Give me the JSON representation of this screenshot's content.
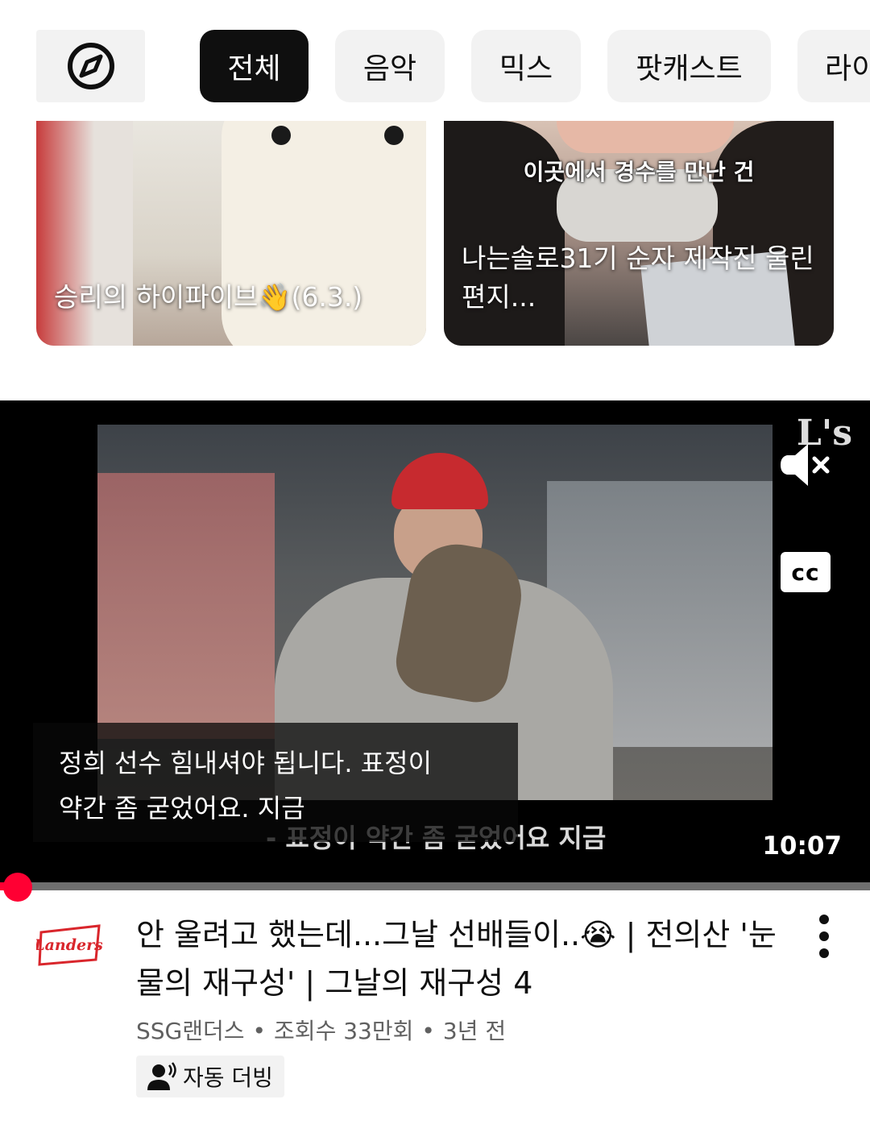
{
  "chips": {
    "explore_icon": "compass-icon",
    "items": [
      {
        "label": "전체",
        "active": true
      },
      {
        "label": "음악",
        "active": false
      },
      {
        "label": "믹스",
        "active": false
      },
      {
        "label": "팟캐스트",
        "active": false
      },
      {
        "label": "라이",
        "active": false
      }
    ]
  },
  "shorts": [
    {
      "title": "승리의 하이파이브👋(6.3.)"
    },
    {
      "overlay_text": "이곳에서 경수를 만난 건",
      "title": "나는솔로31기 순자 제작진 울린 편지..."
    }
  ],
  "player": {
    "watermark": "L's",
    "mute_icon": "muted-volume-icon",
    "cc_label": "cc",
    "caption_line1": "정희 선수 힘내셔야 됩니다. 표정이",
    "caption_line2": "약간 좀 굳었어요. 지금",
    "burned_subtitle": "- 표정이 약간 좀 굳었어요 지금",
    "duration": "10:07",
    "progress_fraction": 0.005
  },
  "video": {
    "channel_logo_text": "Landers",
    "title": "안 울려고 했는데...그날 선배들이..😭 | 전의산 '눈물의 재구성' | 그날의 재구성 4",
    "channel": "SSG랜더스",
    "views": "조회수 33만회",
    "age": "3년 전",
    "dub_label": "자동 더빙",
    "dub_icon": "voice-dub-icon",
    "more_icon": "more-vert-icon"
  },
  "colors": {
    "accent": "#ff0033",
    "chip_active": "#0f0f0f",
    "chip_bg": "#f2f2f2"
  }
}
